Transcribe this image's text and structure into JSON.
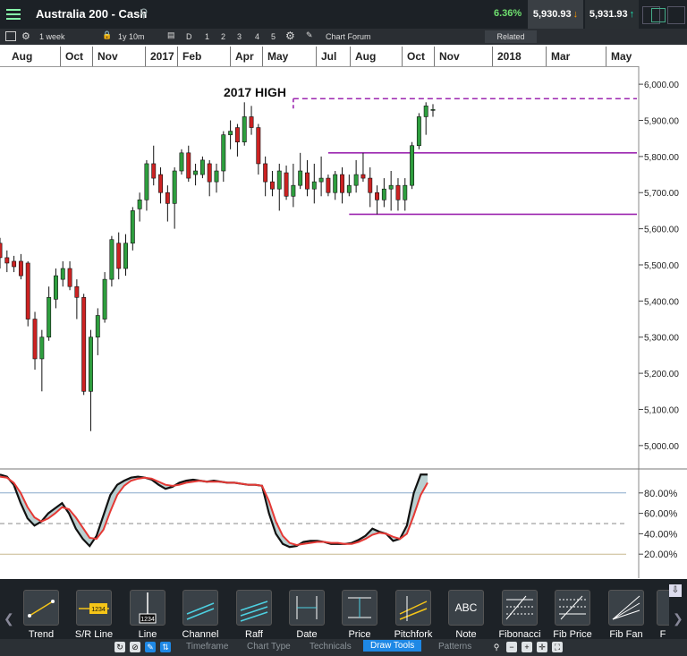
{
  "title_bar": {
    "instrument": "Australia 200 - Cash",
    "change_pct": "6.36%",
    "sell_price": "5,930.93",
    "buy_price": "5,931.93"
  },
  "toolbar": {
    "interval": "1 week",
    "range": "1y 10m",
    "periods": [
      "D",
      "1",
      "2",
      "3",
      "4",
      "5"
    ],
    "forum": "Chart Forum",
    "related": "Related"
  },
  "timeline": [
    "Aug",
    "Oct",
    "Nov",
    "2017",
    "Feb",
    "Apr",
    "May",
    "Jul",
    "Aug",
    "Oct",
    "Nov",
    "2018",
    "Mar",
    "May"
  ],
  "chart_data": [
    {
      "type": "candlestick",
      "title": "",
      "annotation": "2017 HIGH",
      "y_ticks": [
        "6,000.00",
        "5,900.00",
        "5,800.00",
        "5,700.00",
        "5,600.00",
        "5,500.00",
        "5,400.00",
        "5,300.00",
        "5,200.00",
        "5,100.00",
        "5,000.00"
      ],
      "ylim": [
        4960,
        6030
      ],
      "candles": [
        {
          "o": 5560,
          "c": 5520,
          "h": 5575,
          "l": 5490
        },
        {
          "o": 5520,
          "c": 5505,
          "h": 5540,
          "l": 5480
        },
        {
          "o": 5510,
          "c": 5495,
          "h": 5525,
          "l": 5480
        },
        {
          "o": 5510,
          "c": 5470,
          "h": 5530,
          "l": 5460
        },
        {
          "o": 5505,
          "c": 5350,
          "h": 5510,
          "l": 5330
        },
        {
          "o": 5350,
          "c": 5240,
          "h": 5370,
          "l": 5210
        },
        {
          "o": 5240,
          "c": 5300,
          "h": 5320,
          "l": 5150
        },
        {
          "o": 5300,
          "c": 5410,
          "h": 5440,
          "l": 5290
        },
        {
          "o": 5405,
          "c": 5470,
          "h": 5490,
          "l": 5380
        },
        {
          "o": 5460,
          "c": 5490,
          "h": 5510,
          "l": 5440
        },
        {
          "o": 5490,
          "c": 5440,
          "h": 5510,
          "l": 5430
        },
        {
          "o": 5440,
          "c": 5410,
          "h": 5460,
          "l": 5350
        },
        {
          "o": 5410,
          "c": 5150,
          "h": 5420,
          "l": 5140
        },
        {
          "o": 5150,
          "c": 5300,
          "h": 5320,
          "l": 5040
        },
        {
          "o": 5300,
          "c": 5360,
          "h": 5380,
          "l": 5250
        },
        {
          "o": 5350,
          "c": 5460,
          "h": 5480,
          "l": 5340
        },
        {
          "o": 5460,
          "c": 5570,
          "h": 5580,
          "l": 5440
        },
        {
          "o": 5560,
          "c": 5490,
          "h": 5590,
          "l": 5460
        },
        {
          "o": 5490,
          "c": 5560,
          "h": 5585,
          "l": 5470
        },
        {
          "o": 5560,
          "c": 5650,
          "h": 5660,
          "l": 5540
        },
        {
          "o": 5655,
          "c": 5680,
          "h": 5700,
          "l": 5620
        },
        {
          "o": 5680,
          "c": 5780,
          "h": 5790,
          "l": 5650
        },
        {
          "o": 5780,
          "c": 5740,
          "h": 5830,
          "l": 5720
        },
        {
          "o": 5750,
          "c": 5700,
          "h": 5770,
          "l": 5670
        },
        {
          "o": 5700,
          "c": 5670,
          "h": 5720,
          "l": 5620
        },
        {
          "o": 5670,
          "c": 5760,
          "h": 5770,
          "l": 5600
        },
        {
          "o": 5760,
          "c": 5810,
          "h": 5820,
          "l": 5750
        },
        {
          "o": 5810,
          "c": 5740,
          "h": 5830,
          "l": 5730
        },
        {
          "o": 5750,
          "c": 5760,
          "h": 5780,
          "l": 5720
        },
        {
          "o": 5750,
          "c": 5790,
          "h": 5800,
          "l": 5740
        },
        {
          "o": 5780,
          "c": 5730,
          "h": 5790,
          "l": 5690
        },
        {
          "o": 5730,
          "c": 5760,
          "h": 5780,
          "l": 5700
        },
        {
          "o": 5760,
          "c": 5860,
          "h": 5870,
          "l": 5730
        },
        {
          "o": 5860,
          "c": 5870,
          "h": 5900,
          "l": 5820
        },
        {
          "o": 5880,
          "c": 5840,
          "h": 5890,
          "l": 5800
        },
        {
          "o": 5840,
          "c": 5910,
          "h": 5950,
          "l": 5830
        },
        {
          "o": 5910,
          "c": 5880,
          "h": 5940,
          "l": 5860
        },
        {
          "o": 5880,
          "c": 5780,
          "h": 5890,
          "l": 5750
        },
        {
          "o": 5780,
          "c": 5730,
          "h": 5800,
          "l": 5690
        },
        {
          "o": 5730,
          "c": 5710,
          "h": 5760,
          "l": 5690
        },
        {
          "o": 5710,
          "c": 5760,
          "h": 5780,
          "l": 5650
        },
        {
          "o": 5755,
          "c": 5690,
          "h": 5775,
          "l": 5680
        },
        {
          "o": 5690,
          "c": 5720,
          "h": 5780,
          "l": 5660
        },
        {
          "o": 5720,
          "c": 5760,
          "h": 5810,
          "l": 5710
        },
        {
          "o": 5755,
          "c": 5710,
          "h": 5790,
          "l": 5690
        },
        {
          "o": 5710,
          "c": 5730,
          "h": 5780,
          "l": 5670
        },
        {
          "o": 5730,
          "c": 5740,
          "h": 5800,
          "l": 5690
        },
        {
          "o": 5740,
          "c": 5700,
          "h": 5750,
          "l": 5690
        },
        {
          "o": 5700,
          "c": 5750,
          "h": 5760,
          "l": 5680
        },
        {
          "o": 5750,
          "c": 5700,
          "h": 5770,
          "l": 5670
        },
        {
          "o": 5700,
          "c": 5720,
          "h": 5750,
          "l": 5690
        },
        {
          "o": 5720,
          "c": 5750,
          "h": 5790,
          "l": 5700
        },
        {
          "o": 5750,
          "c": 5740,
          "h": 5810,
          "l": 5730
        },
        {
          "o": 5740,
          "c": 5700,
          "h": 5770,
          "l": 5660
        },
        {
          "o": 5700,
          "c": 5680,
          "h": 5720,
          "l": 5640
        },
        {
          "o": 5680,
          "c": 5710,
          "h": 5740,
          "l": 5660
        },
        {
          "o": 5710,
          "c": 5720,
          "h": 5760,
          "l": 5650
        },
        {
          "o": 5720,
          "c": 5680,
          "h": 5740,
          "l": 5650
        },
        {
          "o": 5680,
          "c": 5720,
          "h": 5740,
          "l": 5650
        },
        {
          "o": 5720,
          "c": 5830,
          "h": 5840,
          "l": 5710
        },
        {
          "o": 5830,
          "c": 5910,
          "h": 5920,
          "l": 5820
        },
        {
          "o": 5910,
          "c": 5940,
          "h": 5950,
          "l": 5860
        },
        {
          "o": 5930,
          "c": 5930,
          "h": 5945,
          "l": 5910
        }
      ],
      "levels": [
        {
          "price": 5960,
          "style": "dashed",
          "color": "#9c27b0",
          "from_index": 42
        },
        {
          "price": 5810,
          "style": "solid",
          "color": "#9c27b0",
          "from_index": 47
        },
        {
          "price": 5640,
          "style": "solid",
          "color": "#9c27b0",
          "from_index": 50
        }
      ],
      "colors": {
        "up": "#2e9e3e",
        "down": "#cc2222"
      }
    },
    {
      "type": "line",
      "title": "",
      "y_ticks": [
        "80.00%",
        "60.00%",
        "40.00%",
        "20.00%"
      ],
      "ylim": [
        0,
        100
      ],
      "reference_lines": [
        80,
        50,
        20
      ],
      "series": [
        {
          "color": "#111111",
          "values": [
            98,
            96,
            88,
            70,
            55,
            48,
            52,
            60,
            65,
            70,
            60,
            45,
            35,
            28,
            38,
            58,
            78,
            88,
            92,
            95,
            96,
            95,
            93,
            88,
            84,
            86,
            90,
            92,
            93,
            92,
            91,
            92,
            91,
            90,
            90,
            89,
            88,
            88,
            87,
            60,
            40,
            30,
            27,
            28,
            32,
            33,
            33,
            32,
            30,
            30,
            30,
            31,
            34,
            38,
            45,
            42,
            40,
            33,
            35,
            48,
            80,
            98,
            98
          ]
        },
        {
          "color": "#e53935",
          "values": [
            96,
            95,
            90,
            80,
            66,
            56,
            52,
            55,
            60,
            66,
            64,
            56,
            46,
            36,
            35,
            44,
            62,
            78,
            87,
            92,
            94,
            95,
            94,
            91,
            88,
            87,
            88,
            90,
            91,
            92,
            91,
            91,
            91,
            90,
            90,
            89,
            88,
            88,
            87,
            72,
            52,
            38,
            31,
            29,
            30,
            31,
            32,
            32,
            31,
            31,
            30,
            30,
            32,
            35,
            39,
            41,
            40,
            37,
            35,
            40,
            58,
            78,
            90
          ]
        }
      ]
    }
  ],
  "draw_tools": [
    "Trend",
    "S/R Line",
    "Line",
    "Channel",
    "Raff",
    "Date",
    "Price",
    "Pitchfork",
    "Note",
    "Fibonacci",
    "Fib Price",
    "Fib Fan",
    "F"
  ],
  "note_icon_text": "ABC",
  "sr_icon_text": "1234",
  "bottom_tabs": [
    "Timeframe",
    "Chart Type",
    "Technicals",
    "Draw Tools",
    "Patterns"
  ],
  "active_bottom_tab": "Draw Tools"
}
